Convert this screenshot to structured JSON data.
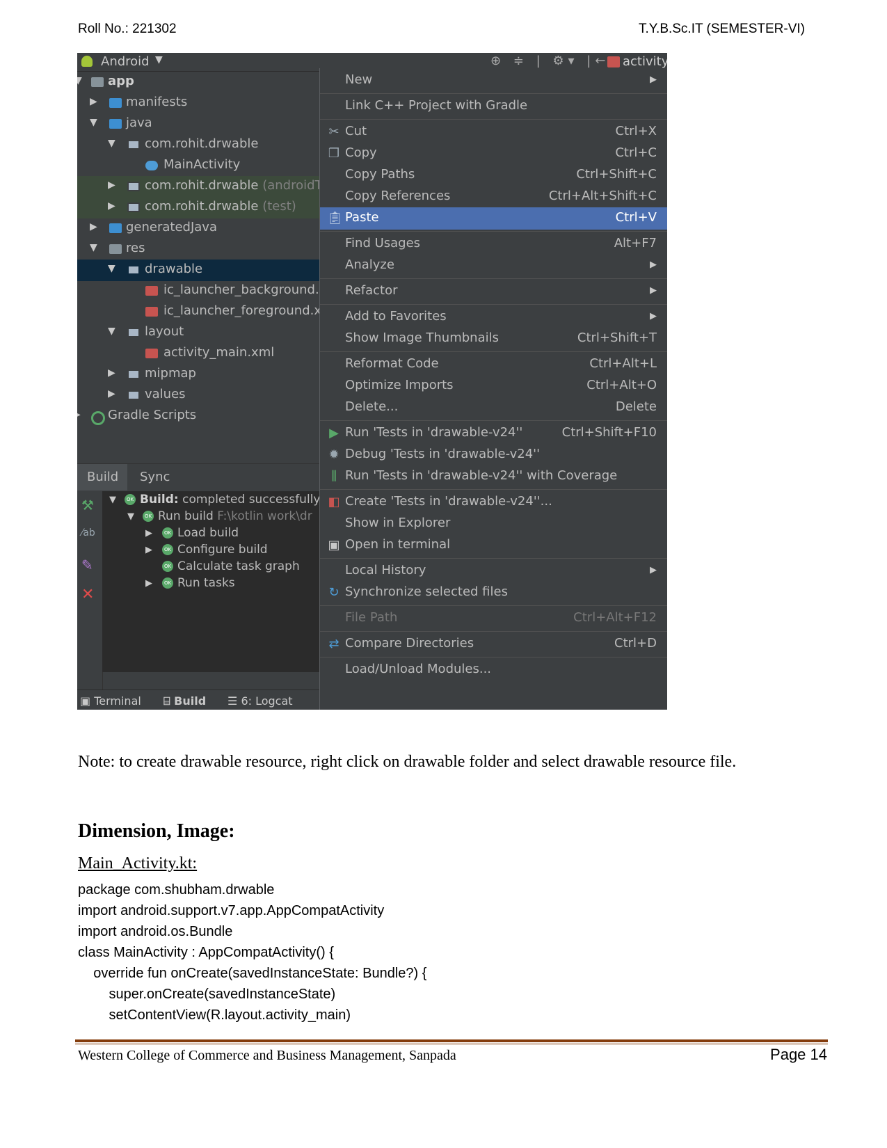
{
  "header": {
    "roll": "Roll No.: 221302",
    "semester": "T.Y.B.Sc.IT (SEMESTER-VI)"
  },
  "ide": {
    "view_label": "Android",
    "editor_tab": "activity",
    "project_tree": [
      "app",
      "manifests",
      "java",
      "com.rohit.drwable",
      "MainActivity",
      "com.rohit.drwable",
      "(androidTe",
      "com.rohit.drwable",
      "(test)",
      "generatedJava",
      "res",
      "drawable",
      "ic_launcher_background.xr",
      "ic_launcher_foreground.xm",
      "layout",
      "activity_main.xml",
      "mipmap",
      "values",
      "Gradle Scripts"
    ],
    "bottom_tabs": [
      "Build",
      "Sync"
    ],
    "build_tree": {
      "status_bold": "Build:",
      "status_text": "completed successfully",
      "run_build": "Run build",
      "run_build_path": "F:\\kotlin work\\dr",
      "items": [
        "Load build",
        "Configure build",
        "Calculate task graph",
        "Run tasks"
      ]
    },
    "status_bar": [
      "Terminal",
      "Build",
      "6: Logcat"
    ]
  },
  "context_menu": {
    "items": [
      {
        "label": "New",
        "shortcut": ""
      },
      {
        "label": "Link C++ Project with Gradle",
        "shortcut": ""
      },
      {
        "label": "Cut",
        "shortcut": "Ctrl+X"
      },
      {
        "label": "Copy",
        "shortcut": "Ctrl+C"
      },
      {
        "label": "Copy Paths",
        "shortcut": "Ctrl+Shift+C"
      },
      {
        "label": "Copy References",
        "shortcut": "Ctrl+Alt+Shift+C"
      },
      {
        "label": "Paste",
        "shortcut": "Ctrl+V"
      },
      {
        "label": "Find Usages",
        "shortcut": "Alt+F7"
      },
      {
        "label": "Analyze",
        "shortcut": ""
      },
      {
        "label": "Refactor",
        "shortcut": ""
      },
      {
        "label": "Add to Favorites",
        "shortcut": ""
      },
      {
        "label": "Show Image Thumbnails",
        "shortcut": "Ctrl+Shift+T"
      },
      {
        "label": "Reformat Code",
        "shortcut": "Ctrl+Alt+L"
      },
      {
        "label": "Optimize Imports",
        "shortcut": "Ctrl+Alt+O"
      },
      {
        "label": "Delete...",
        "shortcut": "Delete"
      },
      {
        "label": "Run 'Tests in 'drawable-v24''",
        "shortcut": "Ctrl+Shift+F10"
      },
      {
        "label": "Debug 'Tests in 'drawable-v24''",
        "shortcut": ""
      },
      {
        "label": "Run 'Tests in 'drawable-v24'' with Coverage",
        "shortcut": ""
      },
      {
        "label": "Create 'Tests in 'drawable-v24''...",
        "shortcut": ""
      },
      {
        "label": "Show in Explorer",
        "shortcut": ""
      },
      {
        "label": "Open in terminal",
        "shortcut": ""
      },
      {
        "label": "Local History",
        "shortcut": ""
      },
      {
        "label": "Synchronize selected files",
        "shortcut": ""
      },
      {
        "label": "File Path",
        "shortcut": "Ctrl+Alt+F12"
      },
      {
        "label": "Compare Directories",
        "shortcut": "Ctrl+D"
      },
      {
        "label": "Load/Unload Modules...",
        "shortcut": ""
      }
    ]
  },
  "doc": {
    "note": "Note: to create drawable resource, right click on drawable folder and select drawable resource file.",
    "heading": "Dimension, Image:",
    "subheading": "Main_Activity.kt:",
    "code": [
      "package com.shubham.drwable",
      "import android.support.v7.app.AppCompatActivity",
      "import android.os.Bundle",
      "class MainActivity : AppCompatActivity() {",
      "    override fun onCreate(savedInstanceState: Bundle?) {",
      "        super.onCreate(savedInstanceState)",
      "        setContentView(R.layout.activity_main)"
    ]
  },
  "footer": {
    "college": "Western College of Commerce and Business Management, Sanpada",
    "page": "Page 14"
  }
}
